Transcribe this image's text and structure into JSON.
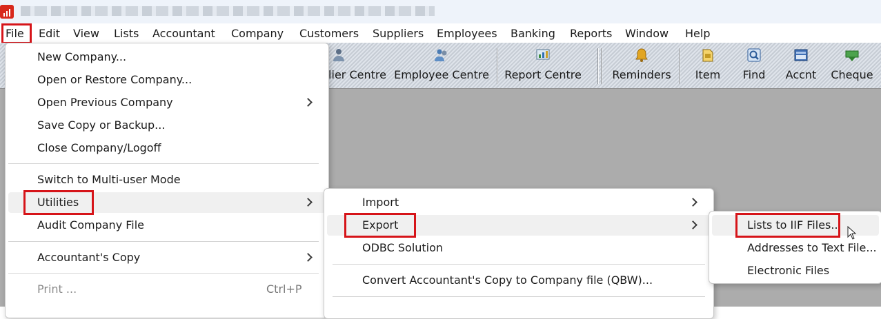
{
  "title_bar": {
    "logo_icon": "qb-bar-chart-icon",
    "blurred_title": ""
  },
  "menubar": {
    "items": [
      "File",
      "Edit",
      "View",
      "Lists",
      "Accountant",
      "Company",
      "Customers",
      "Suppliers",
      "Employees",
      "Banking",
      "Reports",
      "Window",
      "Help"
    ],
    "highlighted": "File"
  },
  "toolbar": {
    "buttons": [
      {
        "label": "lier Centre",
        "icon": "supplier-centre-icon"
      },
      {
        "label": "Employee Centre",
        "icon": "employee-centre-icon"
      },
      {
        "label": "Report Centre",
        "icon": "report-centre-icon"
      },
      {
        "label": "Reminders",
        "icon": "bell-icon"
      },
      {
        "label": "Item",
        "icon": "item-icon"
      },
      {
        "label": "Find",
        "icon": "find-icon"
      },
      {
        "label": "Accnt",
        "icon": "account-icon"
      },
      {
        "label": "Cheque",
        "icon": "cheque-icon"
      }
    ]
  },
  "file_menu": {
    "items": [
      {
        "label": "New Company..."
      },
      {
        "label": "Open or Restore Company..."
      },
      {
        "label": "Open Previous Company",
        "submenu": true
      },
      {
        "label": "Save Copy or Backup..."
      },
      {
        "label": "Close Company/Logoff"
      },
      {
        "label": "Switch to Multi-user Mode"
      },
      {
        "label": "Utilities",
        "submenu": true,
        "highlighted": true
      },
      {
        "label": "Audit Company File"
      },
      {
        "label": "Accountant's Copy",
        "submenu": true
      },
      {
        "label": "Print ...",
        "shortcut": "Ctrl+P",
        "disabled": true
      }
    ]
  },
  "utilities_menu": {
    "items": [
      {
        "label": "Import",
        "submenu": true
      },
      {
        "label": "Export",
        "submenu": true,
        "highlighted": true
      },
      {
        "label": "ODBC Solution"
      },
      {
        "label": "Convert Accountant's Copy to Company file (QBW)..."
      }
    ]
  },
  "export_menu": {
    "items": [
      {
        "label": "Lists to IIF Files...",
        "highlighted": true
      },
      {
        "label": "Addresses to Text File..."
      },
      {
        "label": "Electronic Files"
      }
    ]
  },
  "colors": {
    "highlight_border": "#d61419",
    "workspace": "#acacac",
    "logo": "#d8291c"
  }
}
